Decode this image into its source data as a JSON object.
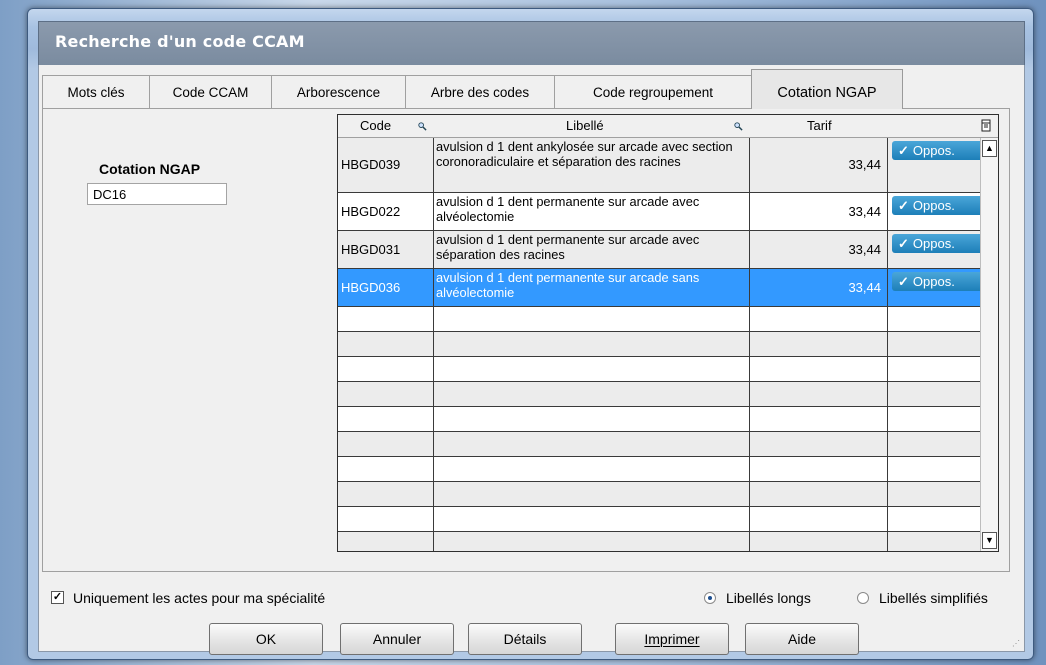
{
  "window": {
    "title": "Recherche d'un code CCAM"
  },
  "tabs": [
    {
      "label": "Mots clés",
      "active": false
    },
    {
      "label": "Code CCAM",
      "active": false
    },
    {
      "label": "Arborescence",
      "active": false
    },
    {
      "label": "Arbre des codes",
      "active": false
    },
    {
      "label": "Code regroupement",
      "active": false
    },
    {
      "label": "Cotation NGAP",
      "active": true
    }
  ],
  "cotation": {
    "label": "Cotation NGAP",
    "value": "DC16"
  },
  "grid": {
    "headers": {
      "code": "Code",
      "libelle": "Libellé",
      "tarif": "Tarif"
    },
    "rows": [
      {
        "code": "HBGD039",
        "libelle": "avulsion d 1 dent ankylosée sur arcade avec section coronoradiculaire et séparation des racines",
        "tarif": "33,44",
        "oppos": "Oppos.",
        "selected": false
      },
      {
        "code": "HBGD022",
        "libelle": "avulsion d 1 dent permanente sur arcade avec alvéolectomie",
        "tarif": "33,44",
        "oppos": "Oppos.",
        "selected": false
      },
      {
        "code": "HBGD031",
        "libelle": "avulsion d 1 dent permanente sur arcade avec séparation des racines",
        "tarif": "33,44",
        "oppos": "Oppos.",
        "selected": false
      },
      {
        "code": "HBGD036",
        "libelle": "avulsion d 1 dent permanente sur arcade sans alvéolectomie",
        "tarif": "33,44",
        "oppos": "Oppos.",
        "selected": true
      }
    ]
  },
  "options": {
    "uniquement": {
      "label": "Uniquement les actes pour ma spécialité",
      "checked": true
    },
    "libelles_longs": {
      "label": "Libellés longs",
      "selected": true
    },
    "libelles_simplifies": {
      "label": "Libellés simplifiés",
      "selected": false
    }
  },
  "buttons": {
    "ok": "OK",
    "annuler": "Annuler",
    "details": "Détails",
    "imprimer": "Imprimer",
    "aide": "Aide"
  },
  "colors": {
    "selection": "#3399ff",
    "oppos_badge": "#1d7fb8",
    "title_bar": "#7a8b9f"
  }
}
